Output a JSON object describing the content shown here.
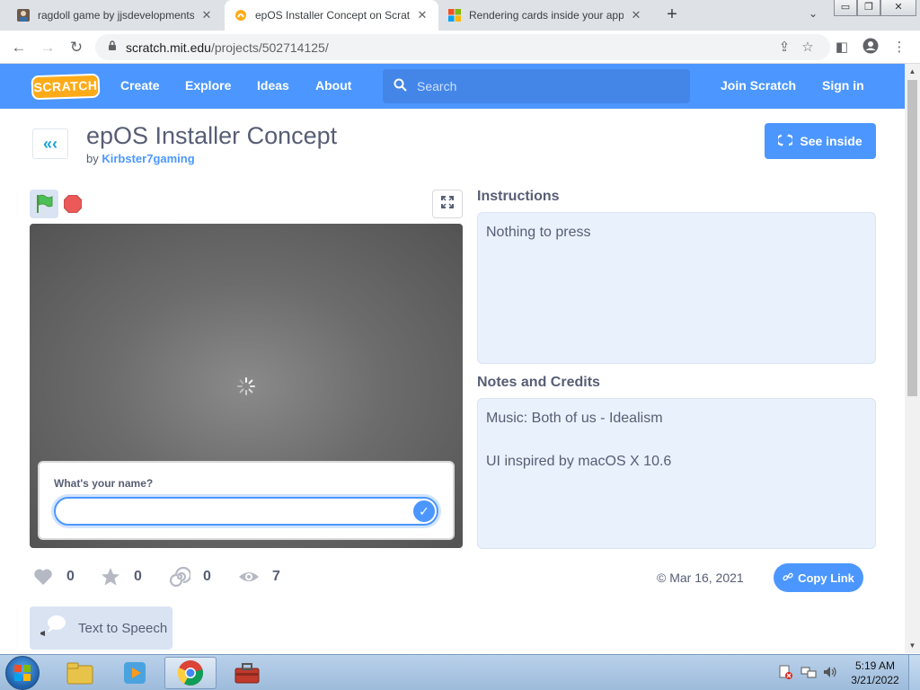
{
  "browser": {
    "tabs": [
      {
        "title": "ragdoll game by jjsdevelopments",
        "close": "✕",
        "favicon": "scratch-user-icon"
      },
      {
        "title": "epOS Installer Concept on Scratch",
        "close": "✕",
        "favicon": "scratch-cat-icon"
      },
      {
        "title": "Rendering cards inside your app",
        "close": "✕",
        "favicon": "windows-logo-icon"
      }
    ],
    "new_tab": "+",
    "url_host": "scratch.mit.edu",
    "url_path": "/projects/502714125/"
  },
  "navbar": {
    "logo": "SCRATCH",
    "links": [
      "Create",
      "Explore",
      "Ideas",
      "About"
    ],
    "search_placeholder": "Search",
    "join": "Join Scratch",
    "signin": "Sign in"
  },
  "project": {
    "title": "epOS Installer Concept",
    "by": "by",
    "author": "Kirbster7gaming",
    "see_inside": "See inside",
    "ask_question": "What's your name?",
    "instructions_title": "Instructions",
    "instructions": "Nothing to press",
    "notes_title": "Notes and Credits",
    "notes": [
      "Music: Both of us - Idealism",
      "UI inspired by macOS X 10.6"
    ],
    "stats": {
      "loves": "0",
      "favorites": "0",
      "remixes": "0",
      "views": "7"
    },
    "date": "© Mar 16, 2021",
    "copy_link": "Copy Link",
    "tts": "Text to Speech"
  },
  "taskbar": {
    "time": "5:19 AM",
    "date": "3/21/2022"
  },
  "colors": {
    "scratch_blue": "#4c97ff",
    "scratch_text": "#575e75",
    "panel_bg": "#e9f1fc"
  }
}
